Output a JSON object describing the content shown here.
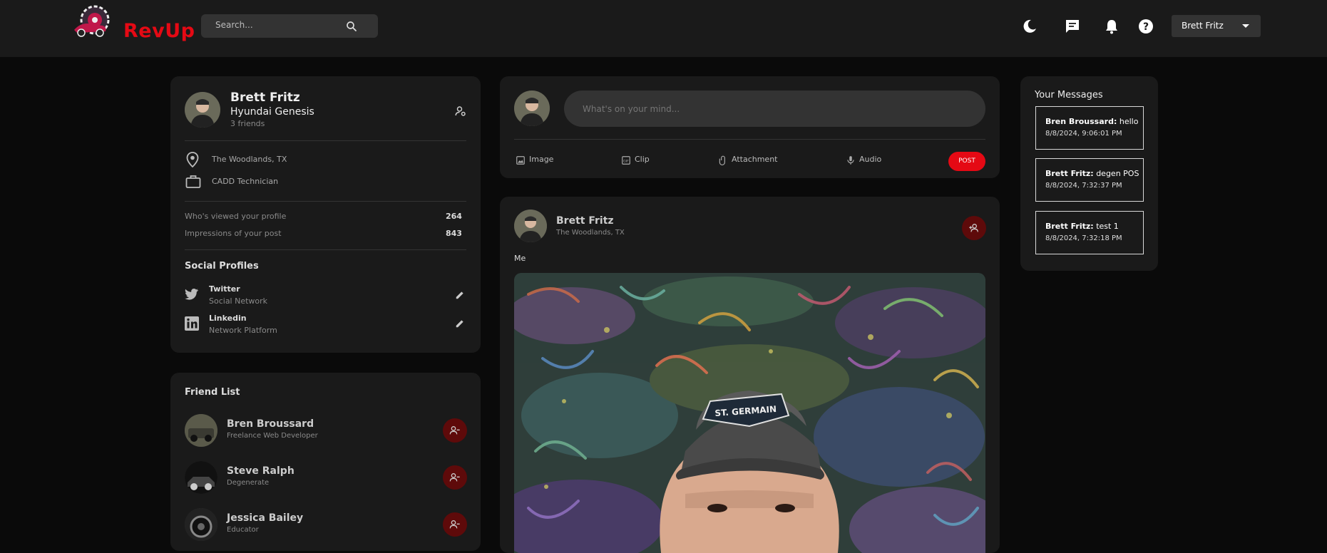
{
  "navbar": {
    "brand": "RevUp",
    "search_placeholder": "Search...",
    "icons": [
      "moon-icon",
      "chat-icon",
      "bell-icon",
      "help-icon"
    ],
    "user": "Brett Fritz"
  },
  "profile": {
    "name": "Brett Fritz",
    "car": "Hyundai Genesis",
    "friends": "3 friends",
    "location": "The Woodlands, TX",
    "occupation": "CADD Technician",
    "stats": [
      {
        "label": "Who's viewed your profile",
        "value": "264"
      },
      {
        "label": "Impressions of your post",
        "value": "843"
      }
    ],
    "social_title": "Social Profiles",
    "socials": [
      {
        "name": "Twitter",
        "type": "Social Network"
      },
      {
        "name": "Linkedin",
        "type": "Network Platform"
      }
    ]
  },
  "friend_list": {
    "title": "Friend List",
    "friends": [
      {
        "name": "Bren Broussard",
        "title": "Freelance Web Developer"
      },
      {
        "name": "Steve Ralph",
        "title": "Degenerate"
      },
      {
        "name": "Jessica Bailey",
        "title": "Educator"
      }
    ]
  },
  "composer": {
    "placeholder": "What's on your mind...",
    "actions": [
      "Image",
      "Clip",
      "Attachment",
      "Audio"
    ],
    "post_label": "POST"
  },
  "post": {
    "author": "Brett Fritz",
    "location": "The Woodlands, TX",
    "caption": "Me",
    "hat_text": "ST. GERMAIN"
  },
  "messages": {
    "title": "Your Messages",
    "items": [
      {
        "sender": "Bren Broussard:",
        "text": "hello",
        "time": "8/8/2024, 9:06:01 PM"
      },
      {
        "sender": "Brett Fritz:",
        "text": "degen POS",
        "time": "8/8/2024, 7:32:37 PM"
      },
      {
        "sender": "Brett Fritz:",
        "text": "test 1",
        "time": "8/8/2024, 7:32:18 PM"
      }
    ]
  },
  "colors": {
    "accent": "#e50914",
    "dark_accent": "#5e0a0a",
    "card": "#1a1a1a",
    "background": "#0a0a0a"
  }
}
